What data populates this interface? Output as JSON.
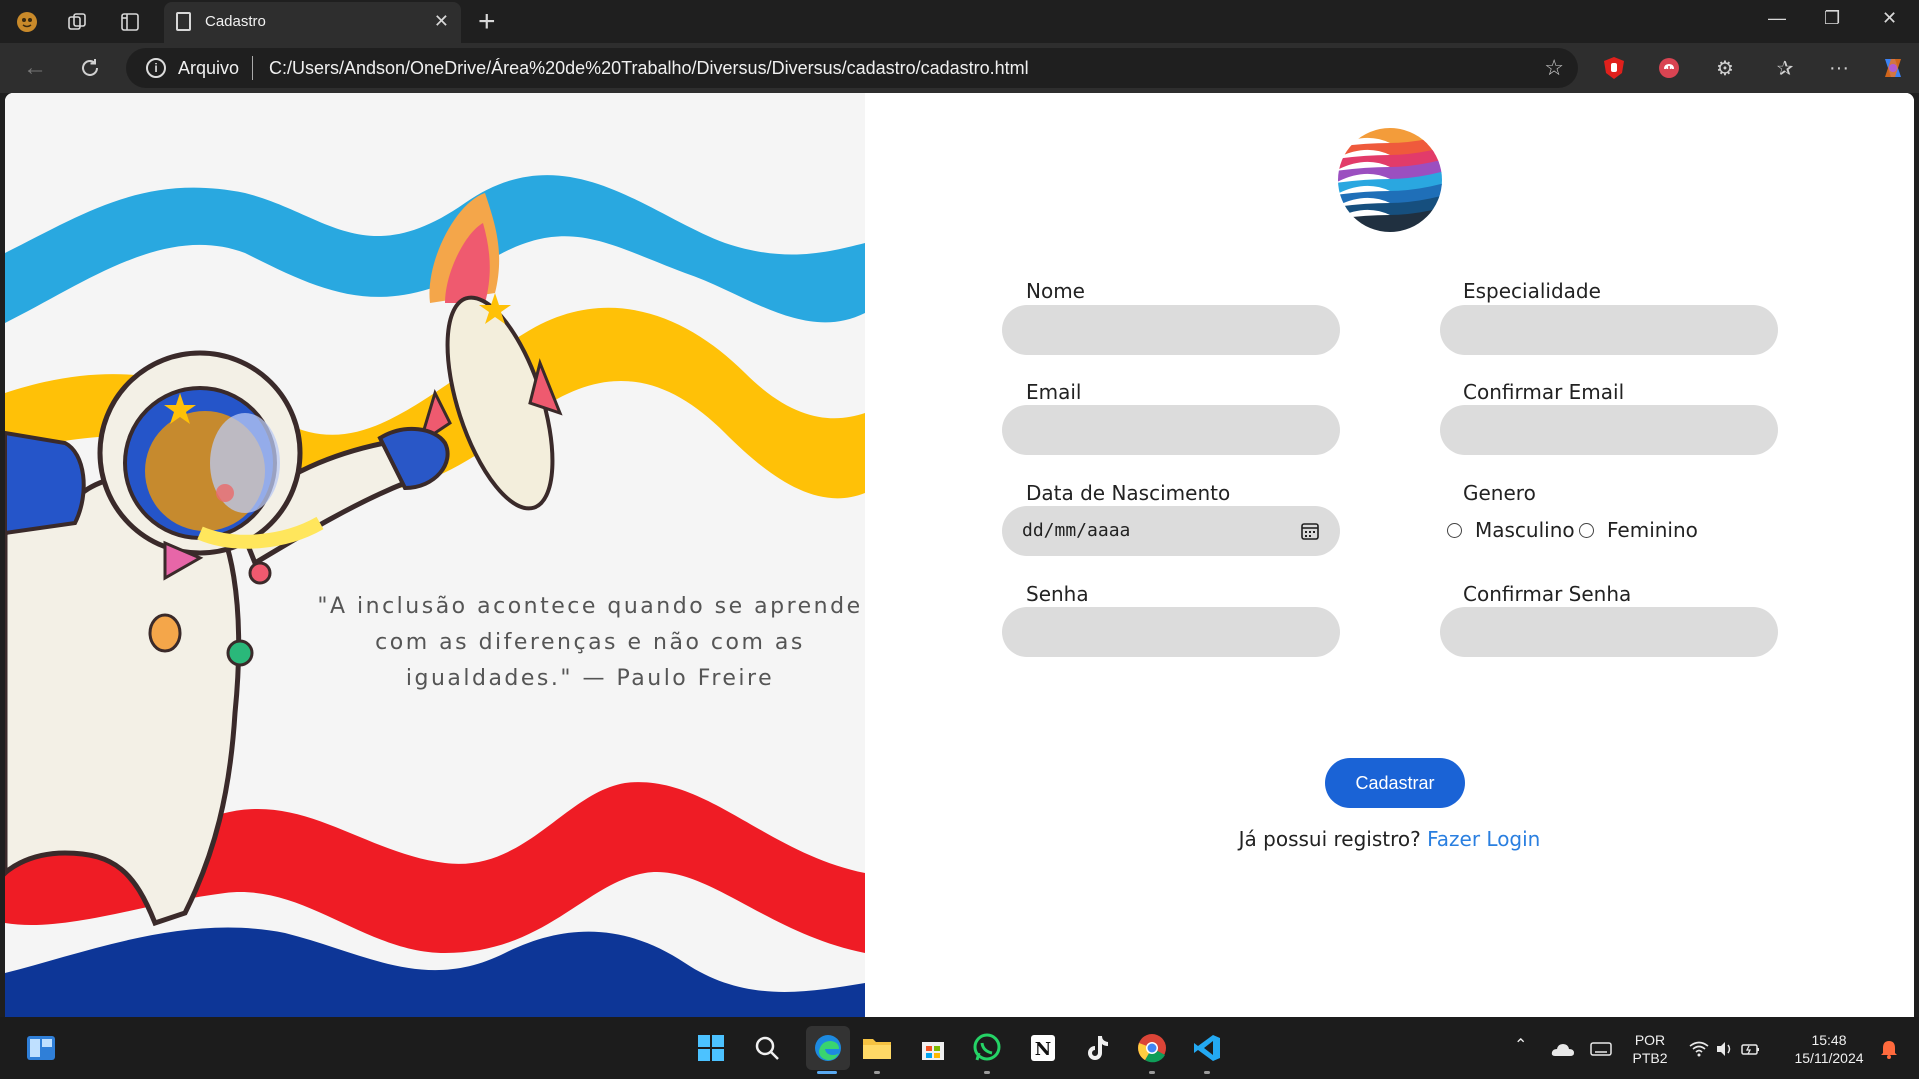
{
  "browser": {
    "tab_title": "Cadastro",
    "scheme_label": "Arquivo",
    "url": "C:/Users/Andson/OneDrive/Área%20de%20Trabalho/Diversus/Diversus/cadastro/cadastro.html"
  },
  "left_panel": {
    "quote": "\"A inclusão acontece quando se aprende com as diferenças e não com as igualdades.\" — Paulo Freire",
    "wave_colors": [
      "#29a8e0",
      "#ffc107",
      "#ef1c25",
      "#0d3697"
    ]
  },
  "form": {
    "labels": {
      "nome": "Nome",
      "especialidade": "Especialidade",
      "email": "Email",
      "confirmar_email": "Confirmar Email",
      "data_nascimento": "Data de Nascimento",
      "genero": "Genero",
      "senha": "Senha",
      "confirmar_senha": "Confirmar Senha"
    },
    "date_placeholder": "dd/mm/aaaa",
    "gender_options": [
      "Masculino",
      "Feminino"
    ],
    "submit_label": "Cadastrar",
    "login_prompt": "Já possui registro?",
    "login_link": "Fazer Login",
    "accent_color": "#1a63d6",
    "input_bg": "#dcdcdc"
  },
  "taskbar": {
    "language": "POR",
    "layout": "PTB2",
    "time": "15:48",
    "date": "15/11/2024"
  }
}
